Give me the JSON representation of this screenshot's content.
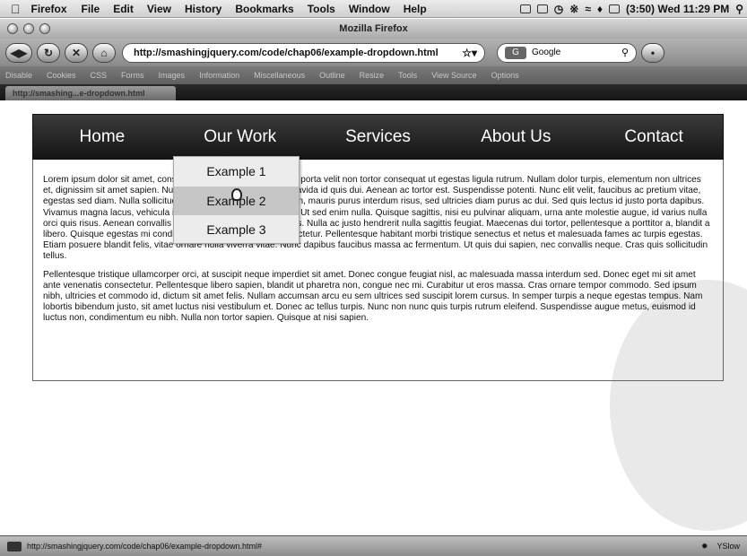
{
  "menubar": {
    "app": "Firefox",
    "items": [
      "File",
      "Edit",
      "View",
      "History",
      "Bookmarks",
      "Tools",
      "Window",
      "Help"
    ],
    "clock": "(3:50) Wed 11:29 PM"
  },
  "window": {
    "title": "Mozilla Firefox"
  },
  "toolbar": {
    "url": "http://smashingjquery.com/code/chap06/example-dropdown.html",
    "search_placeholder": "Google",
    "search_engine": "G"
  },
  "devbar": {
    "items": [
      "Disable",
      "Cookies",
      "CSS",
      "Forms",
      "Images",
      "Information",
      "Miscellaneous",
      "Outline",
      "Resize",
      "Tools",
      "View Source",
      "Options"
    ]
  },
  "tab": {
    "title": "http://smashing...e-dropdown.html"
  },
  "nav": {
    "items": [
      "Home",
      "Our Work",
      "Services",
      "About Us",
      "Contact"
    ]
  },
  "dropdown": {
    "items": [
      "Example 1",
      "Example 2",
      "Example 3"
    ],
    "hovered_index": 1
  },
  "content": {
    "paragraphs": [
      "Lorem ipsum dolor sit amet, consectetur adipiscing elit. Aliquam porta velit non tortor consequat ut egestas ligula rutrum. Nullam dolor turpis, elementum non ultrices et, dignissim sit amet sapien. Nulla in tellus ut erat commodo gravida id quis dui. Aenean ac tortor est. Suspendisse potenti. Nunc elit velit, faucibus ac pretium vitae, egestas sed diam. Nulla sollicitudin, tellus at vulputate accumsan, mauris purus interdum risus, sed ultricies diam purus ac dui. Sed quis lectus id justo porta dapibus. Vivamus magna lacus, vehicula in porttitor non, iaculis quis nisl. Ut sed enim nulla. Quisque sagittis, nisi eu pulvinar aliquam, urna ante molestie augue, id varius nulla orci quis risus. Aenean convallis orci non dolor malesuada luctus. Nulla ac justo hendrerit nulla sagittis feugiat. Maecenas dui tortor, pellentesque a porttitor a, blandit a libero. Quisque egestas mi condimentum felis fermentum consectetur. Pellentesque habitant morbi tristique senectus et netus et malesuada fames ac turpis egestas. Etiam posuere blandit felis, vitae ornare nulla viverra vitae. Nunc dapibus faucibus massa ac fermentum. Ut quis dui sapien, nec convallis neque. Cras quis sollicitudin tellus.",
      "Pellentesque tristique ullamcorper orci, at suscipit neque imperdiet sit amet. Donec congue feugiat nisl, ac malesuada massa interdum sed. Donec eget mi sit amet ante venenatis consectetur. Pellentesque libero sapien, blandit ut pharetra non, congue nec mi. Curabitur ut eros massa. Cras ornare tempor commodo. Sed ipsum nibh, ultricies et commodo id, dictum sit amet felis. Nullam accumsan arcu eu sem ultrices sed suscipit lorem cursus. In semper turpis a neque egestas tempus. Nam lobortis bibendum justo, sit amet luctus nisi vestibulum et. Donec ac tellus turpis. Nunc non nunc quis turpis rutrum eleifend. Suspendisse augue metus, euismod id luctus non, condimentum eu nibh. Nulla non tortor sapien. Quisque at nisi sapien."
    ]
  },
  "statusbar": {
    "url": "http://smashingjquery.com/code/chap06/example-dropdown.html#",
    "addon": "YSlow"
  }
}
